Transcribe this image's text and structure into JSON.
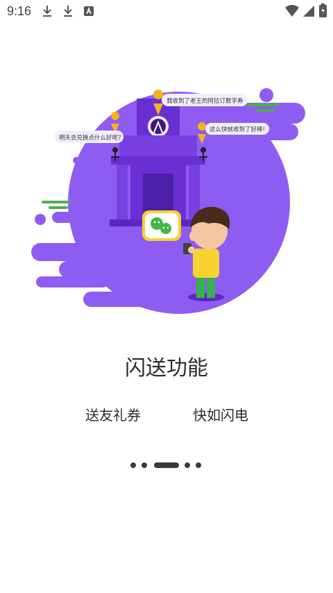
{
  "status_bar": {
    "time": "9:16"
  },
  "illustration": {
    "bubble_top": "我收到了老王的阿拉订数字券",
    "bubble_left": "明天去兑换点什么好呢?",
    "bubble_right": "这么快就收到了好棒!"
  },
  "main": {
    "title": "闪送功能",
    "feature_left": "送友礼券",
    "feature_right": "快如闪电"
  },
  "pagination": {
    "total": 5,
    "active_index": 2
  },
  "colors": {
    "purple": "#8b5cf6",
    "dark_purple": "#6d3fd6",
    "green": "#4caf50",
    "yellow": "#f6d330"
  }
}
